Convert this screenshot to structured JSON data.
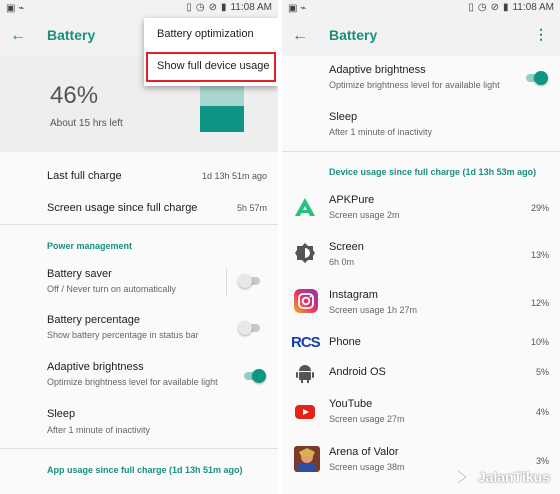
{
  "status_bar": {
    "time": "11:08 AM"
  },
  "left_screen": {
    "title": "Battery",
    "battery_percent": "46%",
    "battery_level": 0.46,
    "time_left": "About 15 hrs left",
    "menu": {
      "items": [
        "Battery optimization",
        "Show full device usage"
      ]
    },
    "last_full_charge": {
      "label": "Last full charge",
      "value": "1d 13h 51m ago"
    },
    "screen_usage": {
      "label": "Screen usage since full charge",
      "value": "5h 57m"
    },
    "power_section": "Power management",
    "battery_saver": {
      "title": "Battery saver",
      "subtitle": "Off / Never turn on automatically",
      "on": false
    },
    "battery_percentage": {
      "title": "Battery percentage",
      "subtitle": "Show battery percentage in status bar",
      "on": false
    },
    "adaptive_brightness": {
      "title": "Adaptive brightness",
      "subtitle": "Optimize brightness level for available light",
      "on": true
    },
    "sleep": {
      "title": "Sleep",
      "subtitle": "After 1 minute of inactivity"
    },
    "app_usage_section": "App usage since full charge (1d 13h 51m ago)"
  },
  "right_screen": {
    "title": "Battery",
    "adaptive_brightness": {
      "title": "Adaptive brightness",
      "subtitle": "Optimize brightness level for available light",
      "on": true
    },
    "sleep": {
      "title": "Sleep",
      "subtitle": "After 1 minute of inactivity"
    },
    "device_usage_section": "Device usage since full charge (1d 13h 53m ago)",
    "apps": [
      {
        "name": "APKPure",
        "sub": "Screen usage 2m",
        "pct": "29%",
        "icon": "apkpure-icon"
      },
      {
        "name": "Screen",
        "sub": "6h 0m",
        "pct": "13%",
        "icon": "brightness-icon"
      },
      {
        "name": "Instagram",
        "sub": "Screen usage 1h 27m",
        "pct": "12%",
        "icon": "instagram-icon"
      },
      {
        "name": "Phone",
        "sub": "",
        "pct": "10%",
        "icon": "rcs-icon"
      },
      {
        "name": "Android OS",
        "sub": "",
        "pct": "5%",
        "icon": "android-icon"
      },
      {
        "name": "YouTube",
        "sub": "Screen usage 27m",
        "pct": "4%",
        "icon": "youtube-icon"
      },
      {
        "name": "Arena of Valor",
        "sub": "Screen usage 38m",
        "pct": "3%",
        "icon": "arena-of-valor-icon"
      }
    ]
  },
  "watermark": "JalanTikus",
  "colors": {
    "accent": "#1a8f7f",
    "highlight": "#e2202a",
    "battery_fill": "#0f9583"
  }
}
